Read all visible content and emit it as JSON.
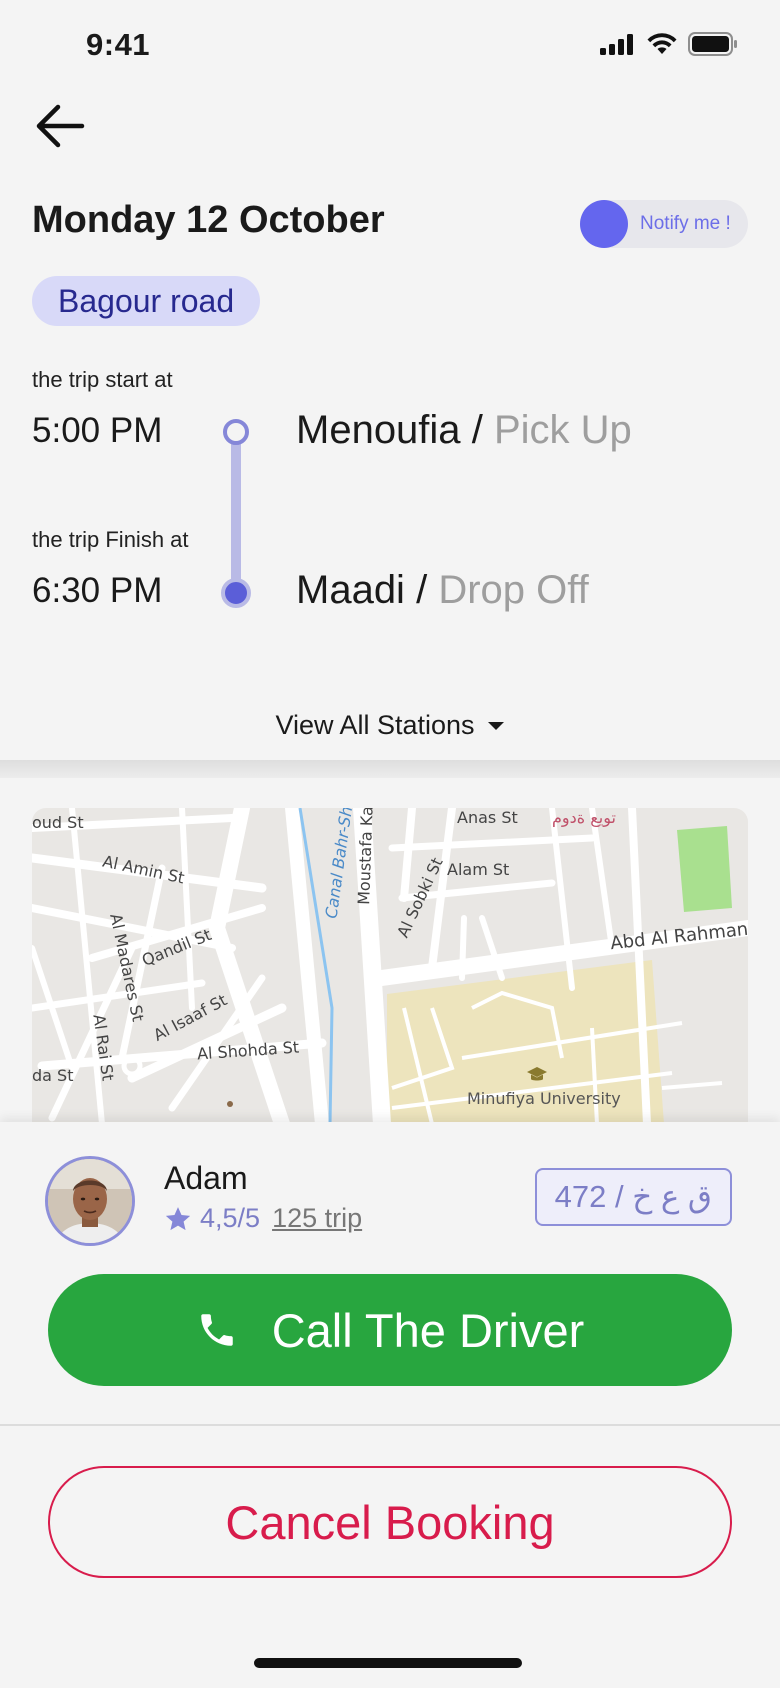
{
  "status_bar": {
    "time": "9:41"
  },
  "header": {
    "date_title": "Monday 12 October",
    "notify_label": "Notify me !"
  },
  "route": {
    "name": "Bagour road"
  },
  "trip": {
    "start_caption": "the trip start at",
    "start_time": "5:00 PM",
    "start_station": "Menoufia",
    "start_action": "Pick Up",
    "finish_caption": "the trip Finish at",
    "finish_time": "6:30 PM",
    "end_station": "Maadi",
    "end_action": "Drop Off",
    "separator": "/"
  },
  "view_all_label": "View All Stations",
  "map": {
    "labels": {
      "oud_st": "oud St",
      "al_amin_st": "Al Amin St",
      "canal": "Canal Bahr-She",
      "moustafa": "Moustafa Ka",
      "anas_st": "Anas St",
      "arabic": "تويع ةدوم",
      "alam_st": "Alam St",
      "al_sobki": "Al Sobki St",
      "abd_al_rahman": "Abd Al Rahman",
      "qandil": "Qandil St",
      "al_madares": "Al Madares St",
      "al_isaaf": "Al Isaaf St",
      "al_shohda": "Al Shohda St",
      "da_st": "da St",
      "al_rai": "Al Rai St",
      "university": "Minufiya University"
    },
    "colors": {
      "road": "#ffffff",
      "block": "#e9e7e4",
      "campus": "#ede4bd",
      "park": "#a9e08f",
      "water": "#8cc4f0"
    }
  },
  "driver": {
    "name": "Adam",
    "rating": "4,5/5",
    "trips": "125 trip",
    "plate": "472 / ق ع خ"
  },
  "actions": {
    "call_label": "Call The Driver",
    "cancel_label": "Cancel Booking"
  },
  "colors": {
    "accent": "#6466ee",
    "call_green": "#28a63f",
    "cancel_red": "#d81c4c",
    "chip_bg": "#d8d9f8"
  },
  "icons": {
    "back": "arrow-left-icon",
    "notify": "toggle-knob",
    "call": "phone-icon",
    "star": "star-icon",
    "dropdown": "caret-down-icon",
    "university": "graduation-cap-icon"
  }
}
